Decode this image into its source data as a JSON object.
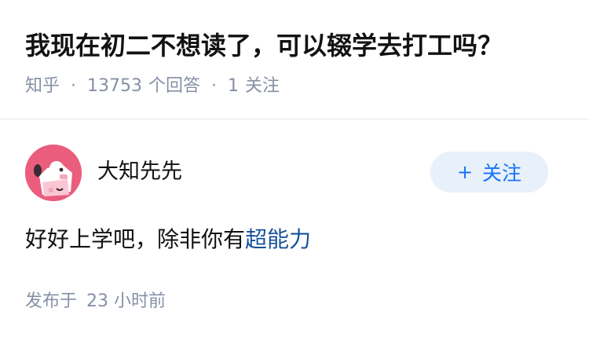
{
  "question": {
    "title": "我现在初二不想读了，可以辍学去打工吗？",
    "source": "知乎",
    "answer_count": "13753",
    "answer_label": "个回答",
    "follow_count": "1",
    "follow_label": "关注"
  },
  "answer": {
    "author": "大知先先",
    "follow_button": {
      "icon": "plus-icon",
      "plus": "+",
      "label": "关注"
    },
    "text_prefix": "好好上学吧，除非你有",
    "text_link": "超能力",
    "published_label": "发布于",
    "published_time": "23 小时前"
  },
  "colors": {
    "primary_text": "#121212",
    "secondary_text": "#8590a6",
    "link": "#175199",
    "accent": "#1772f6",
    "button_bg": "#e8f0fa",
    "avatar_bg": "#ea5d7d"
  }
}
